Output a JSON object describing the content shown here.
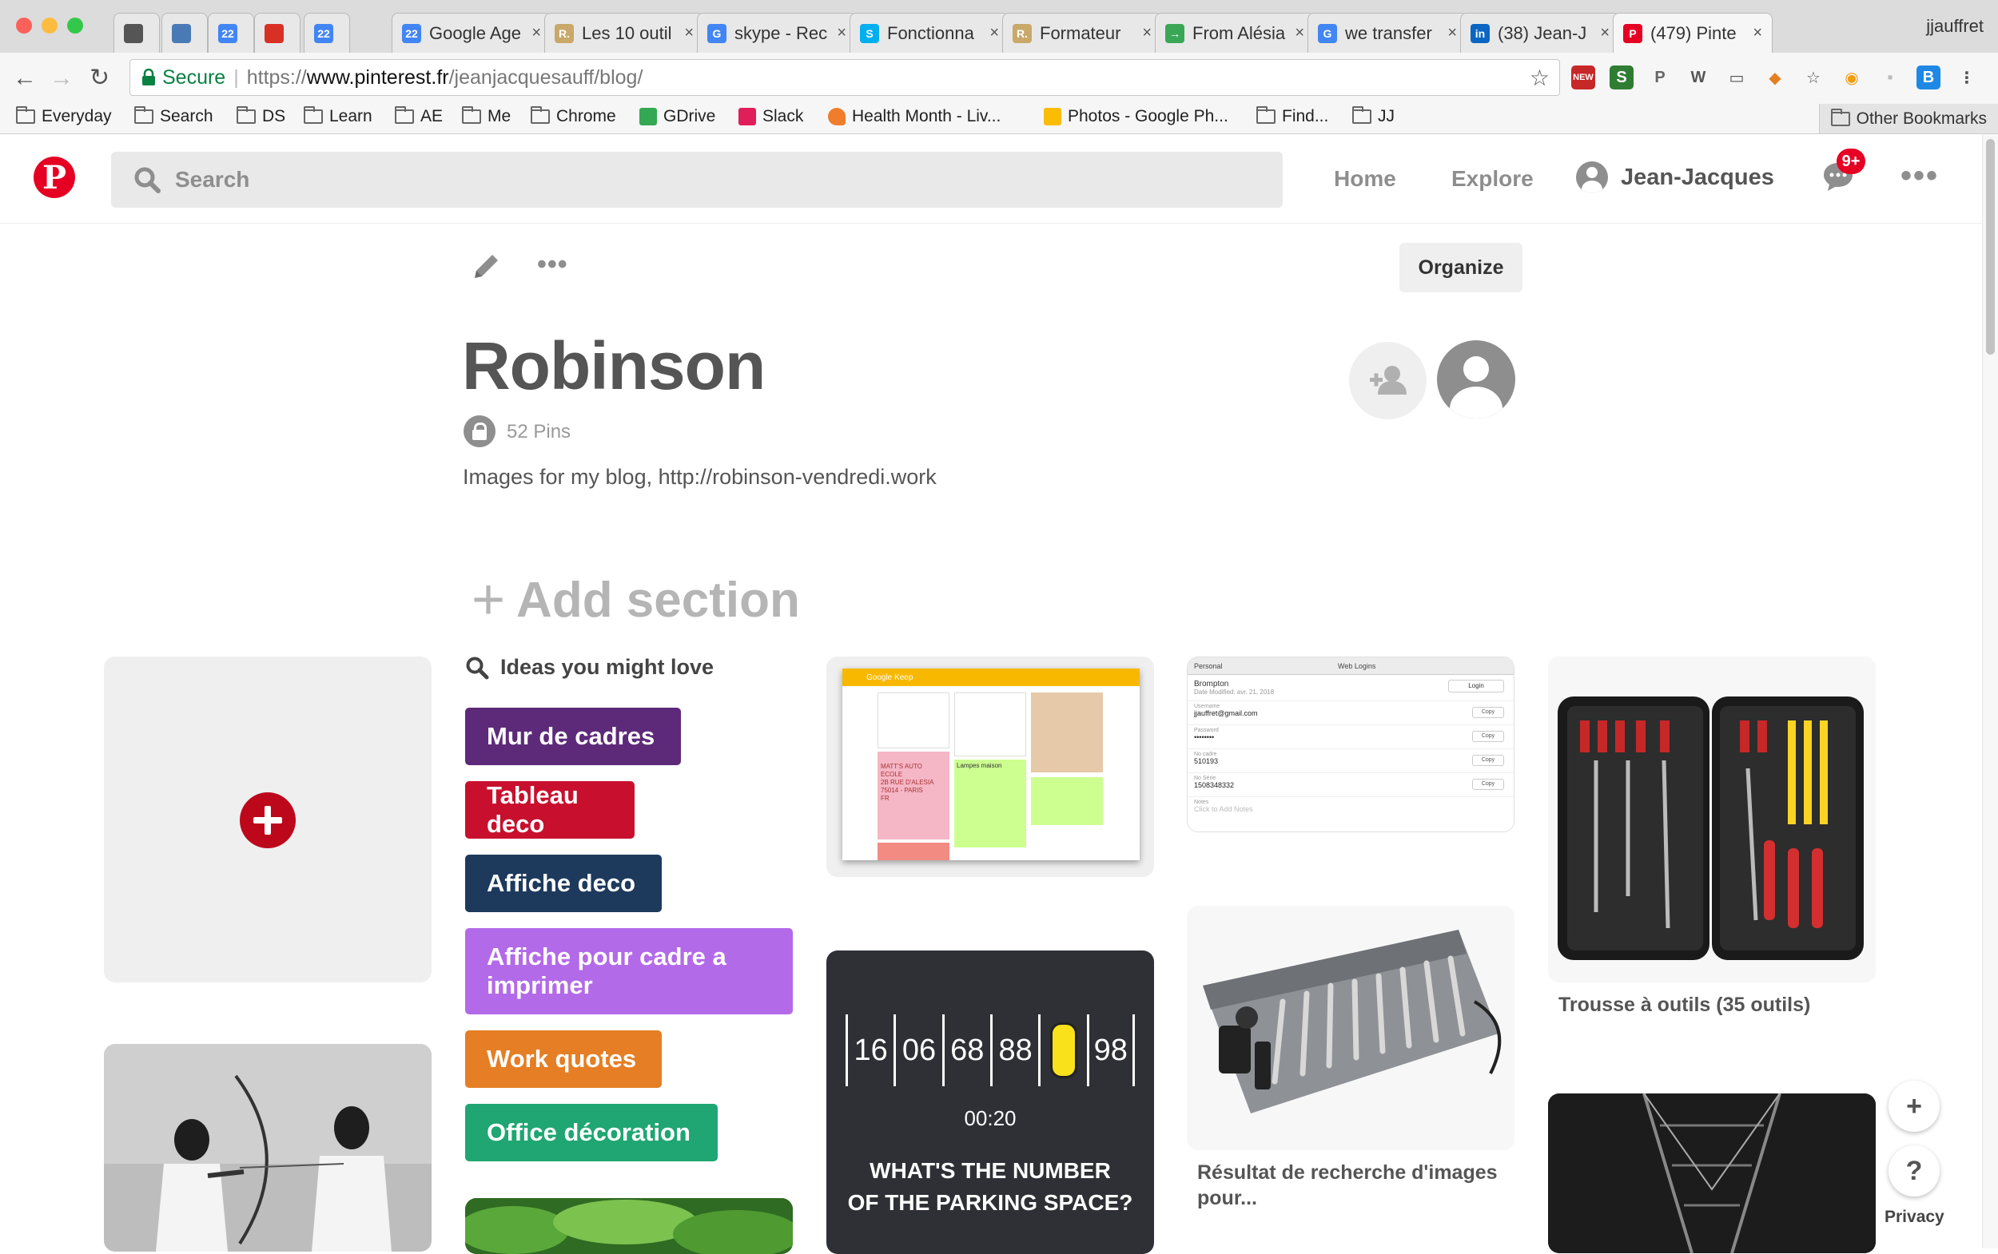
{
  "browser": {
    "profile_name": "jjauffret",
    "tabs": [
      {
        "title": "",
        "icon": "power-icon",
        "color": "#555555"
      },
      {
        "title": "",
        "icon": "tasks-icon",
        "color": "#4a7ab5"
      },
      {
        "title": "",
        "icon": "calendar-22-icon",
        "color": "#4285f4",
        "badge": "22"
      },
      {
        "title": "",
        "icon": "gmail-icon",
        "color": "#d93025"
      },
      {
        "title": "",
        "icon": "calendar-22-icon",
        "color": "#4285f4",
        "badge": "22"
      },
      {
        "title": "Google Age",
        "icon": "calendar-22-icon",
        "color": "#4285f4",
        "badge": "22"
      },
      {
        "title": "Les 10 outil",
        "icon": "r-icon",
        "color": "#c9a86a",
        "badge": "R."
      },
      {
        "title": "skype - Rec",
        "icon": "google-icon",
        "color": "#4285f4",
        "badge": "G"
      },
      {
        "title": "Fonctionna",
        "icon": "skype-icon",
        "color": "#00aff0",
        "badge": "S"
      },
      {
        "title": "Formateur",
        "icon": "r-icon",
        "color": "#c9a86a",
        "badge": "R."
      },
      {
        "title": "From Alésia",
        "icon": "transfer-icon",
        "color": "#3aa757",
        "badge": "→"
      },
      {
        "title": "we transfer",
        "icon": "google-icon",
        "color": "#4285f4",
        "badge": "G"
      },
      {
        "title": "(38) Jean-J",
        "icon": "linkedin-icon",
        "color": "#0a66c2",
        "badge": "in"
      },
      {
        "title": "(479) Pinte",
        "icon": "pinterest-icon",
        "color": "#e60023",
        "badge": "P"
      }
    ],
    "url": {
      "secure_label": "Secure",
      "scheme": "https://",
      "host": "www.pinterest.fr",
      "path": "/jeanjacquesauff/blog/"
    },
    "extensions": [
      {
        "icon": "new-extension-icon",
        "color": "#c62828",
        "label": "NEW"
      },
      {
        "icon": "s-extension-icon",
        "color": "#2e7d32",
        "label": "S"
      },
      {
        "icon": "pinterest-extension-icon",
        "color": "#666666",
        "label": "P"
      },
      {
        "icon": "wikipedia-icon",
        "color": "#555555",
        "label": "W"
      },
      {
        "icon": "cast-icon",
        "color": "#555555",
        "label": "▭"
      },
      {
        "icon": "fox-icon",
        "color": "#e67e22",
        "label": "◆"
      },
      {
        "icon": "star-extension-icon",
        "color": "#555555",
        "label": "☆"
      },
      {
        "icon": "rss-icon",
        "color": "#f39c12",
        "label": "◉"
      },
      {
        "icon": "gray-extension-icon",
        "color": "#bbbbbb",
        "label": "▪"
      },
      {
        "icon": "b-extension-icon",
        "color": "#1e88e5",
        "label": "B"
      },
      {
        "icon": "chrome-menu-icon",
        "color": "#555555",
        "label": "⋮"
      }
    ],
    "bookmarks": [
      {
        "label": "Everyday",
        "type": "folder"
      },
      {
        "label": "Search",
        "type": "folder"
      },
      {
        "label": "DS",
        "type": "folder"
      },
      {
        "label": "Learn",
        "type": "folder"
      },
      {
        "label": "AE",
        "type": "folder"
      },
      {
        "label": "Me",
        "type": "folder"
      },
      {
        "label": "Chrome",
        "type": "folder"
      },
      {
        "label": "GDrive",
        "type": "gdrive",
        "color": "#34a853"
      },
      {
        "label": "Slack",
        "type": "slack",
        "color": "#e01e5a"
      },
      {
        "label": "Health Month - Liv...",
        "type": "heart",
        "color": "#ef7d2b"
      },
      {
        "label": "Photos - Google Ph...",
        "type": "photos",
        "color": "#fbbc04"
      },
      {
        "label": "Find...",
        "type": "folder"
      },
      {
        "label": "JJ",
        "type": "folder"
      }
    ],
    "other_bookmarks": "Other Bookmarks"
  },
  "pinterest": {
    "logo_letter": "P",
    "search_placeholder": "Search",
    "nav": {
      "home": "Home",
      "explore": "Explore",
      "user": "Jean-Jacques"
    },
    "notifications_badge": "9+",
    "more": "•••"
  },
  "board": {
    "more": "•••",
    "organize_label": "Organize",
    "title": "Robinson",
    "pins_count": "52 Pins",
    "description": "Images for my blog, http://robinson-vendredi.work",
    "add_section": "Add section",
    "add_section_plus": "+"
  },
  "ideas": {
    "title": "Ideas you might love",
    "items": [
      {
        "label": "Mur de cadres",
        "color": "#5d2a7a"
      },
      {
        "label": "Tableau deco",
        "color": "#c8102e"
      },
      {
        "label": "Affiche deco",
        "color": "#1d3a5c"
      },
      {
        "label": "Affiche pour cadre a imprimer",
        "color": "#b36ae8"
      },
      {
        "label": "Work quotes",
        "color": "#e57e24"
      },
      {
        "label": "Office décoration",
        "color": "#1fa672"
      }
    ]
  },
  "pins": {
    "keep_app_title": "Google Keep",
    "keep_note_text": "MATT'S AUTO\nECOLE\n2B RUE D'ALESIA\n75014 - PARIS\nFR",
    "keep_note_label": "Lampes maison",
    "login_app": "Web Logins",
    "login_folder": "Personal",
    "login_title": "Brompton",
    "login_subtitle": "Date Modified: avr. 21, 2018",
    "login_button": "Login",
    "login_fields": [
      {
        "label": "Username",
        "value": "jjauffret@gmail.com"
      },
      {
        "label": "Password",
        "value": "••••••••"
      },
      {
        "label": "No cadre",
        "value": "510193"
      },
      {
        "label": "No Série",
        "value": "1508348332"
      },
      {
        "label": "Notes",
        "value": "Click to Add Notes"
      }
    ],
    "copy_label": "Copy",
    "parking_numbers": [
      "16",
      "06",
      "68",
      "88",
      "",
      "98"
    ],
    "parking_time": "00:20",
    "parking_question": "WHAT'S THE NUMBER\nOF THE PARKING SPACE?",
    "toolroll_caption": "Résultat de recherche d'images pour...",
    "toolkit_caption": "Trousse à outils (35 outils)"
  },
  "side": {
    "add": "+",
    "help": "?",
    "privacy": "Privacy"
  }
}
